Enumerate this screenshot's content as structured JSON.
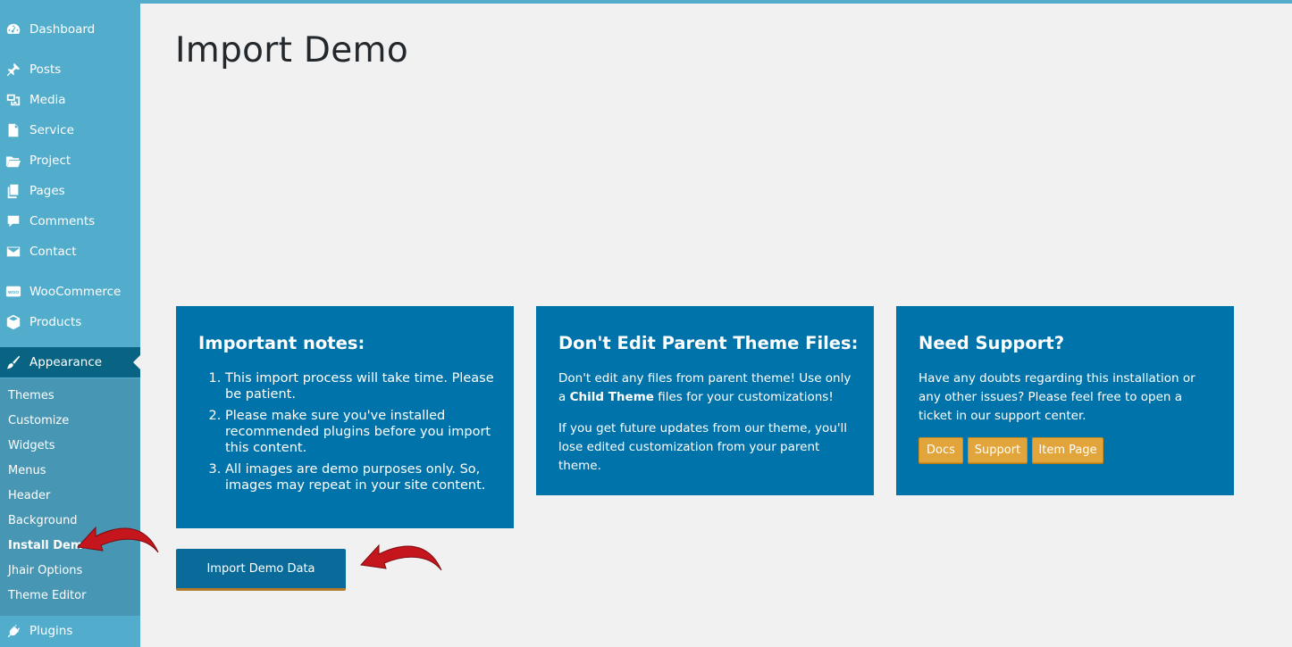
{
  "sidebar": {
    "items": [
      {
        "label": "Dashboard",
        "icon": "dashboard-icon"
      },
      {
        "label": "Posts",
        "icon": "pin-icon"
      },
      {
        "label": "Media",
        "icon": "media-icon"
      },
      {
        "label": "Service",
        "icon": "document-icon"
      },
      {
        "label": "Project",
        "icon": "folder-icon"
      },
      {
        "label": "Pages",
        "icon": "pages-icon"
      },
      {
        "label": "Comments",
        "icon": "comment-icon"
      },
      {
        "label": "Contact",
        "icon": "envelope-icon"
      },
      {
        "label": "WooCommerce",
        "icon": "woo-icon"
      },
      {
        "label": "Products",
        "icon": "box-icon"
      },
      {
        "label": "Appearance",
        "icon": "brush-icon"
      },
      {
        "label": "Plugins",
        "icon": "plug-icon"
      }
    ],
    "submenu": [
      "Themes",
      "Customize",
      "Widgets",
      "Menus",
      "Header",
      "Background",
      "Install Demo",
      "Jhair Options",
      "Theme Editor"
    ],
    "active_sub": "Install Demo",
    "woo_icon_text": "WOO"
  },
  "page": {
    "title": "Import Demo"
  },
  "cards": {
    "notes": {
      "title": "Important notes:",
      "items": [
        "This import process will take time. Please be patient.",
        "Please make sure you've installed recommended plugins before you import this content.",
        "All images are demo purposes only. So, images may repeat in your site content."
      ]
    },
    "theme": {
      "title": "Don't Edit Parent Theme Files:",
      "p1_a": "Don't edit any files from parent theme! Use only a ",
      "p1_bold": "Child Theme",
      "p1_b": " files for your customizations!",
      "p2": "If you get future updates from our theme, you'll lose edited customization from your parent theme."
    },
    "support": {
      "title": "Need Support?",
      "text": "Have any doubts regarding this installation or any other issues? Please feel free to open a ticket in our support center.",
      "buttons": [
        "Docs",
        "Support",
        "Item Page"
      ]
    }
  },
  "import_button": "Import Demo Data",
  "colors": {
    "sidebar": "#52accc",
    "card": "#0073aa",
    "accent_button": "#e1a53b",
    "arrow": "#c4161c"
  }
}
